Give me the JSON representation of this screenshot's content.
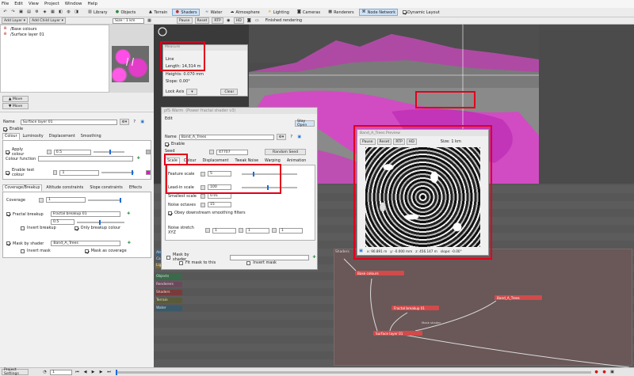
{
  "menu": [
    "File",
    "Edit",
    "View",
    "Project",
    "Window",
    "Help"
  ],
  "toolbar": {
    "add_layer": "Add Layer",
    "add_child_layer": "Add Child Layer",
    "items": [
      {
        "label": "Objects",
        "active": false
      },
      {
        "label": "Terrain",
        "active": false
      },
      {
        "label": "Shaders",
        "active": true
      },
      {
        "label": "Water",
        "active": false
      },
      {
        "label": "Atmosphere",
        "active": false
      },
      {
        "label": "Lighting",
        "active": false
      },
      {
        "label": "Cameras",
        "active": false
      },
      {
        "label": "Renderers",
        "active": false
      },
      {
        "label": "Node Network",
        "active": true
      }
    ],
    "library": "Library",
    "dynamic_layout": "Dynamic Layout"
  },
  "layers": {
    "base": "/Base colours",
    "surface": "/Surface layer 01"
  },
  "move_up": "Move",
  "move_down": "Move",
  "viewport_bar": {
    "size": "Size : 1 km",
    "pause": "Pause",
    "reset": "Reset",
    "rtp": "RTP",
    "hd": "HD",
    "status": "Finished rendering"
  },
  "surface_panel": {
    "name_label": "Name",
    "name_value": "Surface layer 01",
    "enable": "Enable",
    "tabs": [
      "Colour",
      "Luminosity",
      "Displacement",
      "Smoothing"
    ],
    "apply_colour": "Apply colour",
    "apply_colour_value": "0.5",
    "colour_function": "Colour function",
    "enable_test_colour": "Enable test colour",
    "test_colour_value": "1",
    "subtabs": [
      "Coverage/Breakup",
      "Altitude constraints",
      "Slope constraints",
      "Effects"
    ],
    "coverage": "Coverage",
    "coverage_value": "1",
    "fractal_breakup": "Fractal breakup",
    "fractal_breakup_value": "Fractal breakup 01",
    "fb_value": "0.5",
    "invert_breakup": "Invert breakup",
    "only_breakup_colour": "Only breakup colour",
    "mask_by_shader": "Mask by shader",
    "mask_value": "Band_A_Trees",
    "invert_mask": "Invert mask",
    "mask_as_coverage": "Mask as coverage"
  },
  "measure": {
    "title": "Measure",
    "line": "Line",
    "length": "Length: 14,314 m",
    "heights": "Heights: 0.070 mm",
    "slope": "Slope: 0.00°",
    "lock_axis": "Lock Axis",
    "clear": "Clear"
  },
  "pfs": {
    "title": "pfS Warm",
    "subtitle": "(Power fractal shader v3)",
    "edit": "Edit",
    "name_label": "Name",
    "name_value": "Band_A_Trees",
    "enable": "Enable",
    "seed_label": "Seed",
    "seed_value": "47707",
    "random_seed": "Random Seed",
    "stay_open": "Stay Open",
    "tabs": [
      "Scale",
      "Colour",
      "Displacement",
      "Tweak Noise",
      "Warping",
      "Animation"
    ],
    "feature_scale": "Feature scale",
    "feature_value": "5",
    "lead_in_scale": "Lead-in scale",
    "lead_in_value": "100",
    "smallest_scale": "Smallest scale",
    "smallest_value": "0.01",
    "noise_octaves": "Noise octaves",
    "octaves_value": "15",
    "obey": "Obey downstream smoothing filters",
    "noise_stretch": "Noise stretch XYZ",
    "stretch_x": "1",
    "stretch_y": "1",
    "stretch_z": "1",
    "mask_by_shader": "Mask by shader",
    "fit_mask": "Fit mask to this",
    "invert_mask": "Invert mask"
  },
  "preview": {
    "title": "Band_A_Trees Preview",
    "buttons": [
      "Pause",
      "Reset",
      "RTP",
      "HD"
    ],
    "size": "Size: 1 km",
    "x": "x: 90.891 m",
    "y": "y: -0.000 mm",
    "z": "z: 456.147 m",
    "slope": "slope: -0.00°"
  },
  "node_net": {
    "label": "Shaders",
    "nodes": [
      "Base colours",
      "Fractal breakup 01",
      "Band_A_Trees",
      "Surface layer 01"
    ],
    "edge_label": "Mask shader"
  },
  "nav": [
    "Atm",
    "Cam",
    "Ligh",
    "Objects",
    "Renderers",
    "Shaders",
    "Terrain",
    "Water"
  ],
  "status": {
    "project_settings": "Project Settings",
    "frame": "1"
  }
}
